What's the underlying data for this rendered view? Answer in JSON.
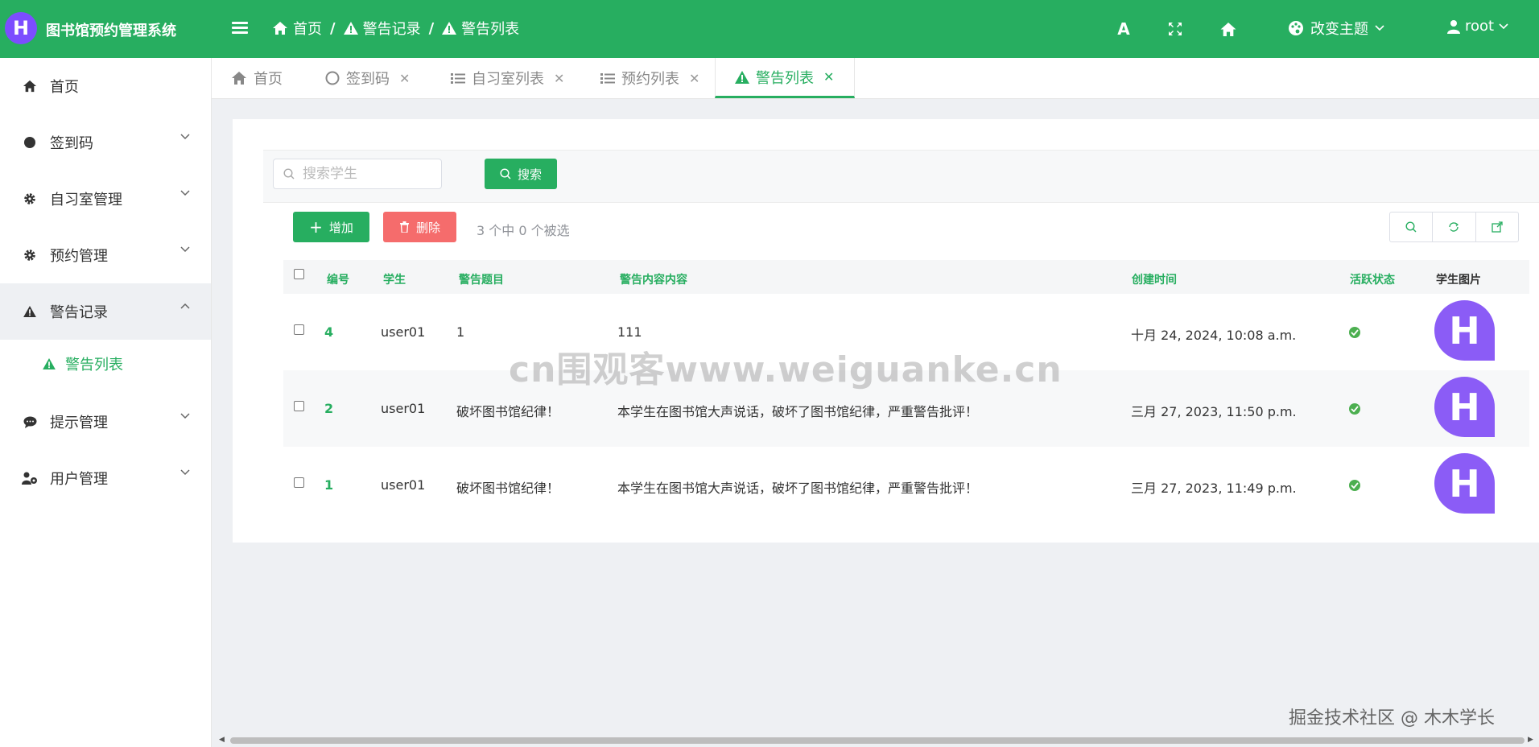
{
  "header": {
    "logo_letter": "H",
    "app_title": "图书馆预约管理系统",
    "breadcrumbs": [
      "首页",
      "警告记录",
      "警告列表"
    ],
    "theme_label": "改变主题",
    "user_name": "root",
    "font_icon_label": "A"
  },
  "sidebar": {
    "items": [
      {
        "label": "首页",
        "icon": "home-icon"
      },
      {
        "label": "签到码",
        "icon": "circle-icon"
      },
      {
        "label": "自习室管理",
        "icon": "gear-icon"
      },
      {
        "label": "预约管理",
        "icon": "gear-icon"
      },
      {
        "label": "警告记录",
        "icon": "warning-icon"
      },
      {
        "label": "提示管理",
        "icon": "chat-icon"
      },
      {
        "label": "用户管理",
        "icon": "user-gear-icon"
      }
    ],
    "submenu_active": "警告列表"
  },
  "tabs": [
    {
      "label": "首页",
      "icon": "home-icon",
      "closable": false
    },
    {
      "label": "签到码",
      "icon": "circle-icon",
      "closable": true
    },
    {
      "label": "自习室列表",
      "icon": "list-icon",
      "closable": true
    },
    {
      "label": "预约列表",
      "icon": "list-icon",
      "closable": true
    },
    {
      "label": "警告列表",
      "icon": "warning-icon",
      "closable": true,
      "active": true
    }
  ],
  "toolbar": {
    "search_placeholder": "搜索学生",
    "search_button": "搜索",
    "add_button": "增加",
    "delete_button": "删除",
    "selection_text": "3 个中 0 个被选"
  },
  "table": {
    "columns": [
      "编号",
      "学生",
      "警告题目",
      "警告内容内容",
      "创建时间",
      "活跃状态",
      "学生图片"
    ],
    "rows": [
      {
        "id": "4",
        "student": "user01",
        "title": "1",
        "content": "111",
        "created": "十月 24, 2024, 10:08 a.m.",
        "active": true,
        "avatar": "H"
      },
      {
        "id": "2",
        "student": "user01",
        "title": "破坏图书馆纪律！",
        "content": "本学生在图书馆大声说话，破坏了图书馆纪律，严重警告批评！",
        "created": "三月 27, 2023, 11:50 p.m.",
        "active": true,
        "avatar": "H"
      },
      {
        "id": "1",
        "student": "user01",
        "title": "破坏图书馆纪律！",
        "content": "本学生在图书馆大声说话，破坏了图书馆纪律，严重警告批评！",
        "created": "三月 27, 2023, 11:49 p.m.",
        "active": true,
        "avatar": "H"
      }
    ]
  },
  "watermark": "cn围观客www.weiguanke.cn",
  "footer_watermark": "掘金技术社区 @ 木木学长",
  "colors": {
    "primary": "#27ae60",
    "danger": "#f56c6c",
    "avatar": "#8b5cf6",
    "success": "#4caf50"
  }
}
